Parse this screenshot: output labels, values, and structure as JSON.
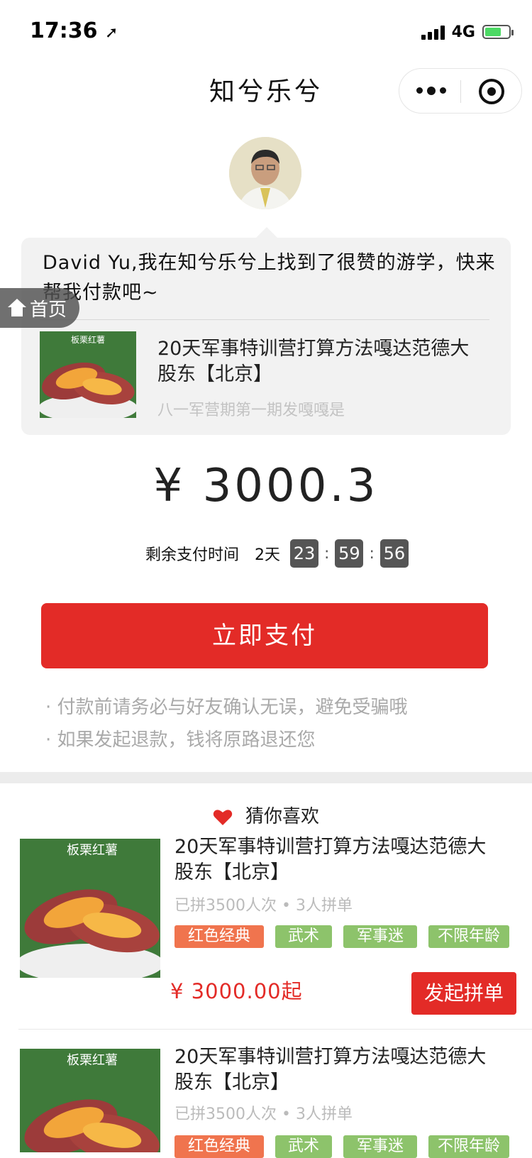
{
  "status_bar": {
    "time": "17:36",
    "network": "4G"
  },
  "nav": {
    "title": "知兮乐兮"
  },
  "message": {
    "text": "David Yu,我在知兮乐兮上找到了很赞的游学，快来帮我付款吧~",
    "product_title": "20天军事特训营打算方法嘎达范德大股东【北京】",
    "product_sub": "八一军营期第一期发嘎嘎是",
    "thumb_label": "板栗红薯"
  },
  "home_button": {
    "label": "首页"
  },
  "price": {
    "text": "¥ 3000.3"
  },
  "timer": {
    "label": "剩余支付时间",
    "days": "2天",
    "hours": "23",
    "minutes": "59",
    "seconds": "56"
  },
  "pay_button": {
    "label": "立即支付"
  },
  "notes": [
    "· 付款前请务必与好友确认无误，避免受骗哦",
    "· 如果发起退款，钱将原路退还您"
  ],
  "recommend": {
    "heading": "猜你喜欢",
    "items": [
      {
        "thumb_label": "板栗红薯",
        "title": "20天军事特训营打算方法嘎达范德大股东【北京】",
        "meta": "已拼3500人次 • 3人拼单",
        "tags": [
          "红色经典",
          "武术",
          "军事迷",
          "不限年龄"
        ],
        "price": "¥ 3000.00起",
        "button": "发起拼单"
      },
      {
        "thumb_label": "板栗红薯",
        "title": "20天军事特训营打算方法嘎达范德大股东【北京】",
        "meta": "已拼3500人次 • 3人拼单",
        "tags": [
          "红色经典",
          "武术",
          "军事迷",
          "不限年龄"
        ]
      }
    ]
  },
  "colors": {
    "accent_red": "#e32b27",
    "tag_orange": "#f0744e",
    "tag_green": "#8dc36b"
  }
}
